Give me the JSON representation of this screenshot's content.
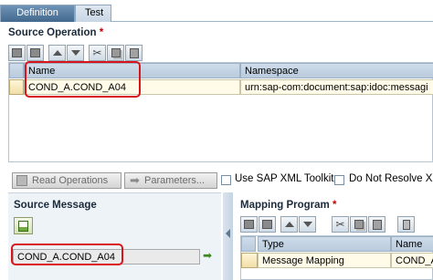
{
  "tabs": [
    {
      "label": "Definition",
      "active": true
    },
    {
      "label": "Test",
      "active": false
    }
  ],
  "source_operation": {
    "title": "Source Operation",
    "required_marker": "*",
    "columns": [
      "Name",
      "Namespace"
    ],
    "rows": [
      {
        "name": "COND_A.COND_A04",
        "namespace": "urn:sap-com:document:sap:idoc:messagi"
      }
    ]
  },
  "actions": {
    "read_operations": "Read Operations",
    "parameters": "Parameters...",
    "use_sap_xml_toolkit": "Use SAP XML Toolkit",
    "do_not_resolve": "Do Not Resolve X"
  },
  "source_message": {
    "title": "Source Message",
    "value": "COND_A.COND_A04"
  },
  "mapping_program": {
    "title": "Mapping Program",
    "required_marker": "*",
    "columns": [
      "Type",
      "Name"
    ],
    "rows": [
      {
        "type": "Message Mapping",
        "name": "COND_A"
      }
    ]
  },
  "colors": {
    "highlight": "#d9141b",
    "tab_active": "#42698f",
    "header_bg": "#b9cbdd",
    "row_bg": "#fffbe8"
  }
}
